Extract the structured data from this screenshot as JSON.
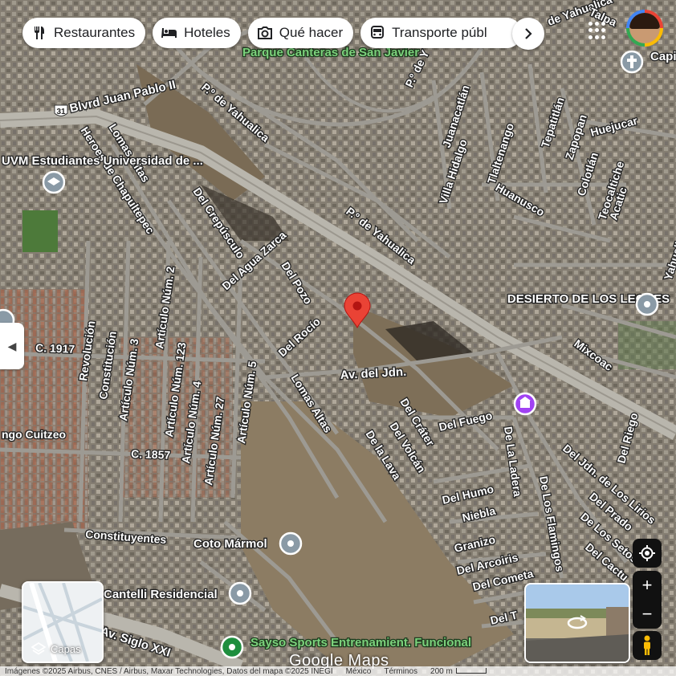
{
  "categories": [
    {
      "label": "Restaurantes",
      "icon": "fork-knife-icon"
    },
    {
      "label": "Hoteles",
      "icon": "bed-icon"
    },
    {
      "label": "Qué hacer",
      "icon": "camera-icon"
    },
    {
      "label": "Transporte públ",
      "icon": "bus-icon"
    }
  ],
  "places": {
    "parque": "Parque Canteras de San Javier",
    "uvm": "UVM Estudiantes Universidad de ...",
    "desierto": "DESIERTO DE LOS LEONES",
    "coto_marmol": "Coto Mármol",
    "cantelli": "Cantelli Residencial",
    "sayso": "Sayso Sports Entrenamient. Funcional",
    "capilla": "Capi Silve",
    "talpa": "Talpa"
  },
  "streets": {
    "blvd_jp": "Blvrd Juan Pablo II",
    "highway_num": "31",
    "yahualica1": "P.º de Yahualica",
    "yahualica2": "P.º de Yahualica",
    "yahualica3": "P.º de Yahualica",
    "yahualica4": "de Yahualica",
    "yahualica_top": "P.º de Y",
    "lomas_altas1": "Lomas Altas",
    "lomas_altas2": "Lomas Altas",
    "heroes": "Heroes de Chapultepec",
    "crepusculo": "Del Crepúsculo",
    "agua_zarca": "Del Agua Zarca",
    "pozo": "Del Pozo",
    "rocio": "Del Rocío",
    "av_jdn": "Av. del Jdn.",
    "crater": "Del Cráter",
    "volcan": "Del Volcán",
    "lava": "De la Lava",
    "fuego": "Del Fuego",
    "ladera": "De La Ladera",
    "flamingos": "De Los Flamingos",
    "humo": "Del Humo",
    "niebla": "Niebla",
    "granizo": "Granizo",
    "arcoiris": "Del Arcoiris",
    "cometa": "Del Cometa",
    "del_t": "Del T",
    "jdn_lirios": "Del Jdn. de Los Lirios",
    "prado": "Del Prado",
    "setos": "De Los Setos",
    "cactus": "Del Cactu",
    "riego": "Del Riego",
    "mixcoac": "Mixcoac",
    "revolucion": "Revolución",
    "constitucion": "Constitución",
    "art3": "Artículo Núm. 3",
    "art2": "Artículo Núm. 2",
    "art123": "Artículo Núm. 123",
    "art4": "Artículo Núm. 4",
    "art27": "Artículo Núm. 27",
    "art5": "Artículo Núm. 5",
    "c1917": "C. 1917",
    "c1857": "C. 1857",
    "cuitzeo": "ngo Cuitzeo",
    "constituyentes": "Constituyentes",
    "av_siglo": "Av. Siglo XXI",
    "juanacatlan": "Juanacatlán",
    "villa_hidalgo": "Villa Hidalgo",
    "tlaltenango": "Tlaltenango",
    "tepatitlan": "Tepatitlán",
    "zapopan": "Zapopan",
    "colotlan": "Colotlán",
    "huejucar": "Huejucar",
    "teocaltiche": "Teocaltiche",
    "acatic": "Acatic",
    "huanusco": "Huanusco",
    "yahualica_right": "Yahualica"
  },
  "layers_label": "Capas",
  "google_logo": "Google Maps",
  "footer": {
    "attribution": "Imágenes ©2025 Airbus, CNES / Airbus, Maxar Technologies, Datos del mapa ©2025 INEGI",
    "country": "México",
    "terms": "Términos",
    "scale": "200 m"
  },
  "colors": {
    "pin": "#ea4335",
    "road": "#9c9a94",
    "highway": "#b8b5ad",
    "terrain": "#7a6f5c",
    "urban": "#8a857c",
    "poi_gray": "#8a9aa6",
    "poi_green": "#1e8e3e",
    "poi_purple": "#a142f4"
  }
}
